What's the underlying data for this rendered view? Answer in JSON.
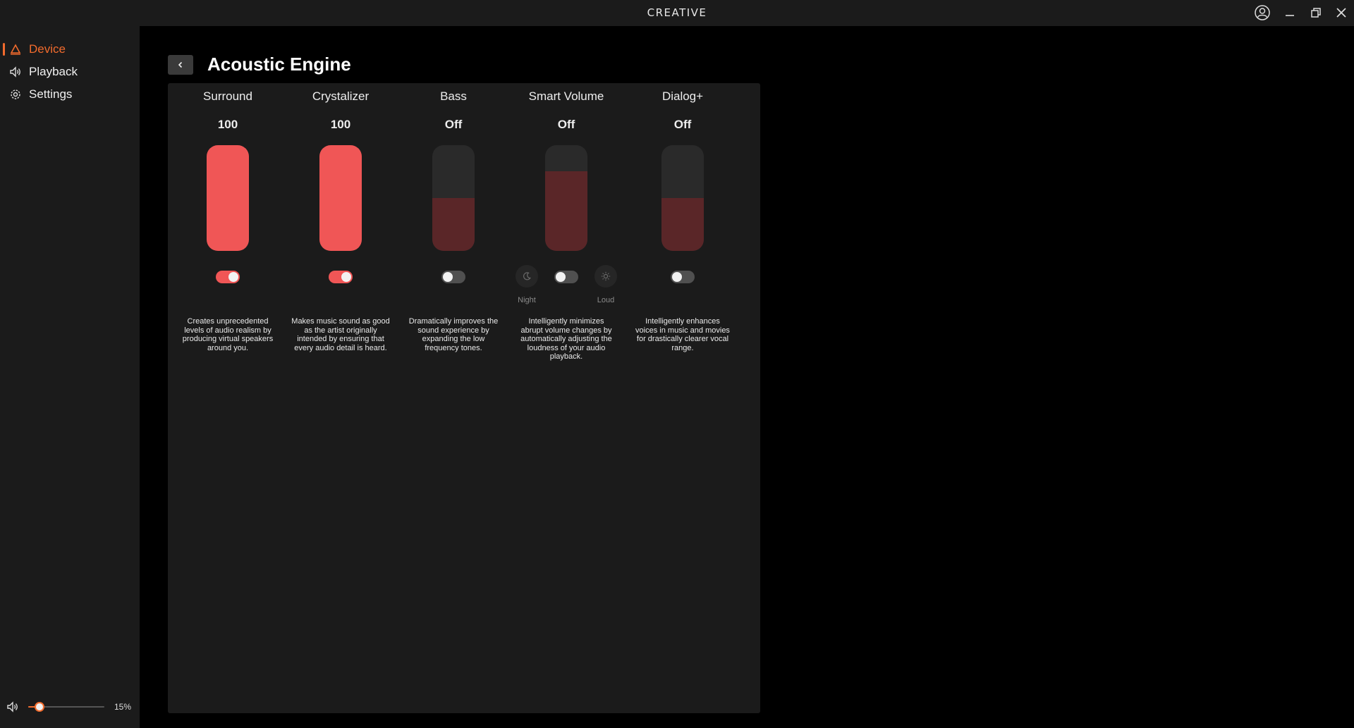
{
  "titlebar": {
    "brand": "CREATIVE"
  },
  "sidebar": {
    "items": [
      {
        "label": "Device",
        "active": true
      },
      {
        "label": "Playback",
        "active": false
      },
      {
        "label": "Settings",
        "active": false
      }
    ],
    "volume": {
      "value": 15,
      "label": "15%"
    }
  },
  "main": {
    "title": "Acoustic Engine",
    "effects": [
      {
        "name": "Surround",
        "value": "100",
        "level": 1.0,
        "enabled": true,
        "description": "Creates unprecedented levels of audio realism by producing virtual speakers around you."
      },
      {
        "name": "Crystalizer",
        "value": "100",
        "level": 1.0,
        "enabled": true,
        "description": "Makes music sound as good as the artist originally intended by ensuring that every audio detail is heard."
      },
      {
        "name": "Bass",
        "value": "Off",
        "level": 0.5,
        "enabled": false,
        "description": "Dramatically improves the sound experience by expanding the low frequency tones."
      },
      {
        "name": "Smart Volume",
        "value": "Off",
        "level": 0.75,
        "enabled": false,
        "description": "Intelligently minimizes abrupt volume changes by automatically adjusting the loudness of your audio playback.",
        "modes": {
          "night": "Night",
          "loud": "Loud"
        }
      },
      {
        "name": "Dialog+",
        "value": "Off",
        "level": 0.5,
        "enabled": false,
        "description": "Intelligently enhances voices in music and movies for drastically clearer vocal range."
      }
    ]
  },
  "colors": {
    "accent": "#f26b2d",
    "slider_on": "#f05656",
    "slider_off": "#5a2628"
  }
}
